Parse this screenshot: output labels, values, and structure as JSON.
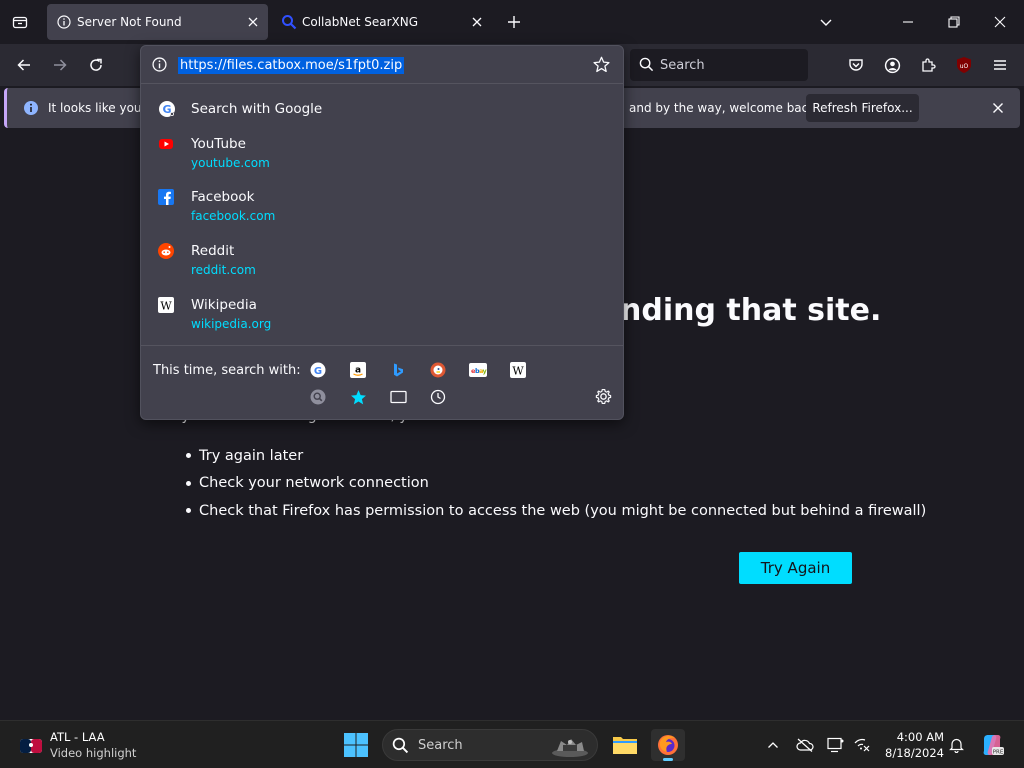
{
  "tabs": [
    {
      "label": "Server Not Found",
      "active": true
    },
    {
      "label": "CollabNet SearXNG",
      "active": false
    }
  ],
  "navbar": {
    "search_placeholder": "Search"
  },
  "notification": {
    "message_left": "It looks like you ha",
    "message_right": "and by the way, welcome back!",
    "refresh_button": "Refresh Firefox..."
  },
  "urlbar": {
    "url": "https://files.catbox.moe/s1fpt0.zip"
  },
  "suggestions": [
    {
      "title": "Search with Google",
      "url": ""
    },
    {
      "title": "YouTube",
      "url": "youtube.com"
    },
    {
      "title": "Facebook",
      "url": "facebook.com"
    },
    {
      "title": "Reddit",
      "url": "reddit.com"
    },
    {
      "title": "Wikipedia",
      "url": "wikipedia.org"
    }
  ],
  "oneoff": {
    "label": "This time, search with:",
    "engines": [
      "Google",
      "Amazon",
      "Bing",
      "DuckDuckGo",
      "eBay",
      "Wikipedia"
    ],
    "modes": [
      "Search",
      "Bookmarks",
      "Tabs",
      "History"
    ]
  },
  "page": {
    "heading": "nding that site.",
    "partial_text": "If you entered the right address, you can:",
    "bullets": [
      "Try again later",
      "Check your network connection",
      "Check that Firefox has permission to access the web (you might be connected but behind a firewall)"
    ],
    "try_again": "Try Again"
  },
  "taskbar": {
    "widget_line1": "ATL - LAA",
    "widget_line2": "Video highlight",
    "search_text": "Search",
    "time": "4:00 AM",
    "date": "8/18/2024"
  },
  "colors": {
    "accent": "#00ddff",
    "url_selection": "#0061e0",
    "chrome_bg": "#2b2a33",
    "page_bg": "#1c1b22"
  }
}
